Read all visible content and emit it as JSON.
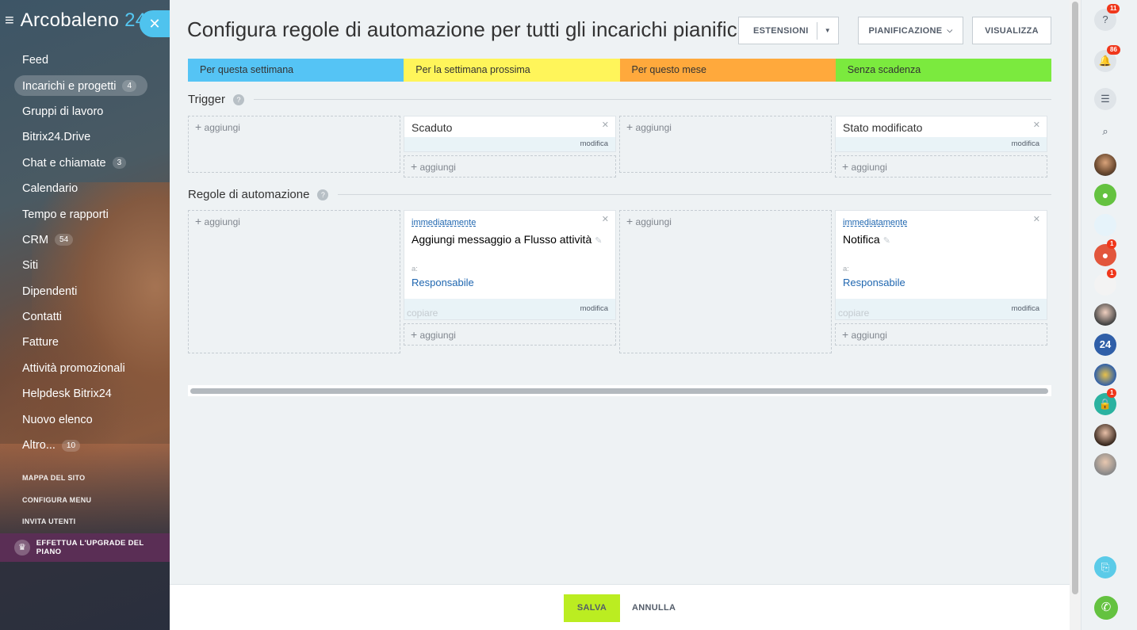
{
  "sidebar": {
    "logo_text": "Arcobaleno",
    "logo_number": "24",
    "close_icon": "close-icon",
    "items": [
      {
        "label": "Feed",
        "counter": ""
      },
      {
        "label": "Incarichi e progetti",
        "counter": "4",
        "active": true
      },
      {
        "label": "Gruppi di lavoro",
        "counter": ""
      },
      {
        "label": "Bitrix24.Drive",
        "counter": ""
      },
      {
        "label": "Chat e chiamate",
        "counter": "3"
      },
      {
        "label": "Calendario",
        "counter": ""
      },
      {
        "label": "Tempo e rapporti",
        "counter": ""
      },
      {
        "label": "CRM",
        "counter": "54"
      },
      {
        "label": "Siti",
        "counter": ""
      },
      {
        "label": "Dipendenti",
        "counter": ""
      },
      {
        "label": "Contatti",
        "counter": ""
      },
      {
        "label": "Fatture",
        "counter": ""
      },
      {
        "label": "Attività promozionali",
        "counter": ""
      },
      {
        "label": "Helpdesk Bitrix24",
        "counter": ""
      },
      {
        "label": "Nuovo elenco",
        "counter": ""
      },
      {
        "label": "Altro...",
        "counter": "10"
      }
    ],
    "small_links": [
      "MAPPA DEL SITO",
      "CONFIGURA MENU",
      "INVITA UTENTI"
    ],
    "upgrade_label": "EFFETTUA L'UPGRADE DEL PIANO"
  },
  "header": {
    "title": "Configura regole di automazione per tutti gli incarichi pianificati",
    "btn_extensions": "ESTENSIONI",
    "btn_planning": "PIANIFICAZIONE",
    "btn_view": "VISUALIZZA"
  },
  "stages": [
    {
      "label": "Per questa settimana",
      "color": "#55c4f5"
    },
    {
      "label": "Per la settimana prossima",
      "color": "#fff55a"
    },
    {
      "label": "Per questo mese",
      "color": "#ffa93c"
    },
    {
      "label": "Senza scadenza",
      "color": "#7bea3e"
    }
  ],
  "triggers": {
    "heading": "Trigger",
    "add_label": "aggiungi",
    "edit_label": "modifica",
    "cards": [
      {
        "col": 1,
        "title": "Scaduto"
      },
      {
        "col": 3,
        "title": "Stato modificato"
      }
    ]
  },
  "rules": {
    "heading": "Regole di automazione",
    "add_label": "aggiungi",
    "edit_label": "modifica",
    "copy_label": "copiare",
    "cards": [
      {
        "col": 1,
        "when": "immediatamente",
        "title": "Aggiungi messaggio a Flusso attività",
        "to_label": "a:",
        "to_value": "Responsabile"
      },
      {
        "col": 3,
        "when": "immediatamente",
        "title": "Notifica",
        "to_label": "a:",
        "to_value": "Responsabile"
      }
    ]
  },
  "footer": {
    "save": "SALVA",
    "cancel": "ANNULLA"
  },
  "rightbar": {
    "help_badge": "11",
    "notif_badge": "86",
    "badges": {
      "user4": "1",
      "user5": "1",
      "lock": "1"
    },
    "numeric_avatar": "24"
  }
}
